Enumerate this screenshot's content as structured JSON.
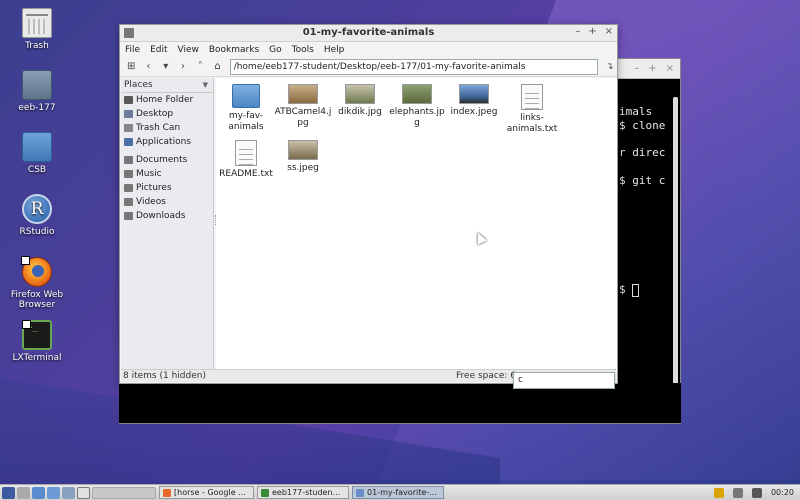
{
  "desktop": {
    "icons": [
      {
        "label": "Trash",
        "icon": "trash-icon"
      },
      {
        "label": "eeb-177",
        "icon": "folder-icon"
      },
      {
        "label": "CSB",
        "icon": "folder-icon"
      },
      {
        "label": "RStudio",
        "icon": "rstudio-icon"
      },
      {
        "label": "Firefox Web Browser",
        "icon": "firefox-icon"
      },
      {
        "label": "LXTerminal",
        "icon": "terminal-icon"
      }
    ]
  },
  "file_manager": {
    "title": "01-my-favorite-animals",
    "menu": [
      "File",
      "Edit",
      "View",
      "Bookmarks",
      "Go",
      "Tools",
      "Help"
    ],
    "path": "/home/eeb177-student/Desktop/eeb-177/01-my-favorite-animals",
    "sidebar": {
      "header": "Places",
      "items": [
        {
          "label": "Home Folder",
          "icon": "home-icon"
        },
        {
          "label": "Desktop",
          "icon": "desktop-icon"
        },
        {
          "label": "Trash Can",
          "icon": "trash-icon"
        },
        {
          "label": "Applications",
          "icon": "applications-icon"
        },
        {
          "label": "Documents",
          "icon": "documents-icon"
        },
        {
          "label": "Music",
          "icon": "music-icon"
        },
        {
          "label": "Pictures",
          "icon": "pictures-icon"
        },
        {
          "label": "Videos",
          "icon": "videos-icon"
        },
        {
          "label": "Downloads",
          "icon": "downloads-icon"
        }
      ]
    },
    "files": [
      {
        "name1": "my-fav-",
        "name2": "animals",
        "type": "folder"
      },
      {
        "name1": "ATBCamel4.j",
        "name2": "pg",
        "type": "image",
        "color": "#b08a5a"
      },
      {
        "name1": "dikdik.jpg",
        "name2": "",
        "type": "image",
        "color": "#7d8a5c"
      },
      {
        "name1": "elephants.jp",
        "name2": "g",
        "type": "image",
        "color": "#6f7d4a"
      },
      {
        "name1": "index.jpeg",
        "name2": "",
        "type": "image",
        "color": "#5c86c4"
      },
      {
        "name1": "links-",
        "name2": "animals.txt",
        "type": "text"
      },
      {
        "name1": "README.txt",
        "name2": "",
        "type": "text"
      },
      {
        "name1": "ss.jpeg",
        "name2": "",
        "type": "image",
        "color": "#9a8c72"
      }
    ],
    "status": "8 items (1 hidden)",
    "free_space": "Free space: 6",
    "typeahead_value": "c"
  },
  "terminal": {
    "lines": [
      "imals",
      "$ clone",
      "r direc",
      "$ git c",
      "$ "
    ]
  },
  "taskbar": {
    "tasks": [
      {
        "label": "[horse - Google ...",
        "color": "#e86a2a"
      },
      {
        "label": "eeb177-studen...",
        "color": "#3a8a3a"
      },
      {
        "label": "01-my-favorite-...",
        "color": "#6a8fc8",
        "active": true
      }
    ],
    "clock": "00:20"
  }
}
